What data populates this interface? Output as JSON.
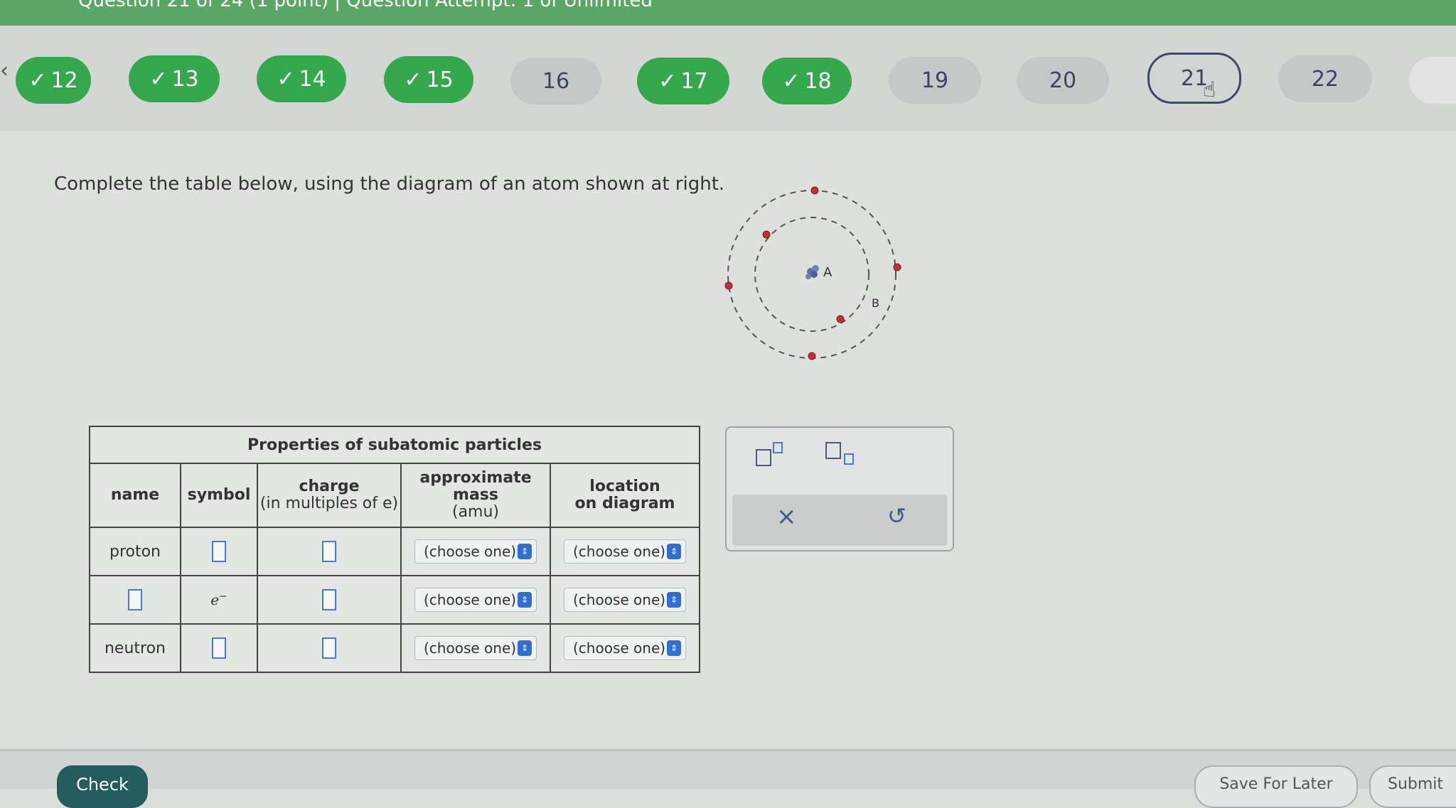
{
  "header": {
    "text": "Question 21 of 24 (1 point)  |  Question Attempt: 1 of Unlimited"
  },
  "nav": {
    "prev_arrow": "‹",
    "questions": [
      {
        "label": "12",
        "status": "done"
      },
      {
        "label": "13",
        "status": "done"
      },
      {
        "label": "14",
        "status": "done"
      },
      {
        "label": "15",
        "status": "done"
      },
      {
        "label": "16",
        "status": "pending"
      },
      {
        "label": "17",
        "status": "done"
      },
      {
        "label": "18",
        "status": "done"
      },
      {
        "label": "19",
        "status": "pending"
      },
      {
        "label": "20",
        "status": "pending"
      },
      {
        "label": "21",
        "status": "current"
      },
      {
        "label": "22",
        "status": "pending"
      }
    ],
    "check_glyph": "✓"
  },
  "instruction": "Complete the table below, using the diagram of an atom shown at right.",
  "diagram": {
    "label_a": "A",
    "label_b": "B"
  },
  "table": {
    "caption": "Properties of subatomic particles",
    "headers": {
      "name": "name",
      "symbol": "symbol",
      "charge": "charge",
      "charge_sub": "(in multiples of e)",
      "mass_line1": "approximate",
      "mass_line2": "mass",
      "mass_line3": "(amu)",
      "location_line1": "location",
      "location_line2": "on diagram"
    },
    "rows": [
      {
        "name": "proton",
        "symbol": "",
        "mass": "(choose one)",
        "location": "(choose one)"
      },
      {
        "name": "",
        "symbol": "e",
        "symbol_sup": "−",
        "mass": "(choose one)",
        "location": "(choose one)"
      },
      {
        "name": "neutron",
        "symbol": "",
        "mass": "(choose one)",
        "location": "(choose one)"
      }
    ]
  },
  "tools": {
    "clear_icon": "×",
    "undo_icon": "↺"
  },
  "footer": {
    "check": "Check",
    "save": "Save For Later",
    "submit": "Submit"
  },
  "colors": {
    "done": "#35a84d",
    "pending": "#c6c8c7",
    "current_border": "#3c4a66",
    "header_band": "#5aa765",
    "check_button": "#245c5f",
    "answer_box_border": "#4a7bd0",
    "select_arrow": "#2f6fd0",
    "electron": "#c0303c"
  }
}
